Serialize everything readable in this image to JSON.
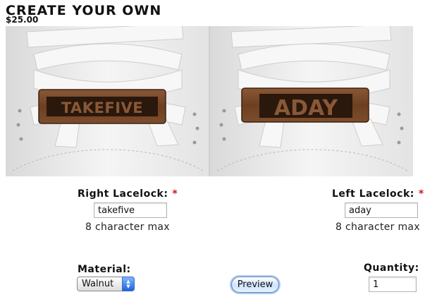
{
  "header": {
    "title": "CREATE YOUR OWN",
    "price": "$25.00"
  },
  "preview_image": {
    "right_tag_text": "TAKEFIVE",
    "left_tag_text": "ADAY"
  },
  "right_lacelock": {
    "label": "Right Lacelock:",
    "required_mark": "*",
    "value": "takefive",
    "hint": "8 character max"
  },
  "left_lacelock": {
    "label": "Left Lacelock:",
    "required_mark": "*",
    "value": "aday",
    "hint": "8 character max"
  },
  "material": {
    "label": "Material:",
    "selected": "Walnut"
  },
  "preview_button": {
    "label": "Preview"
  },
  "quantity": {
    "label": "Quantity:",
    "value": "1"
  },
  "colors": {
    "required": "#d0141c",
    "wood": "#7a4a2a",
    "wood_dark": "#3a2212",
    "lace": "#f4f4f4"
  }
}
